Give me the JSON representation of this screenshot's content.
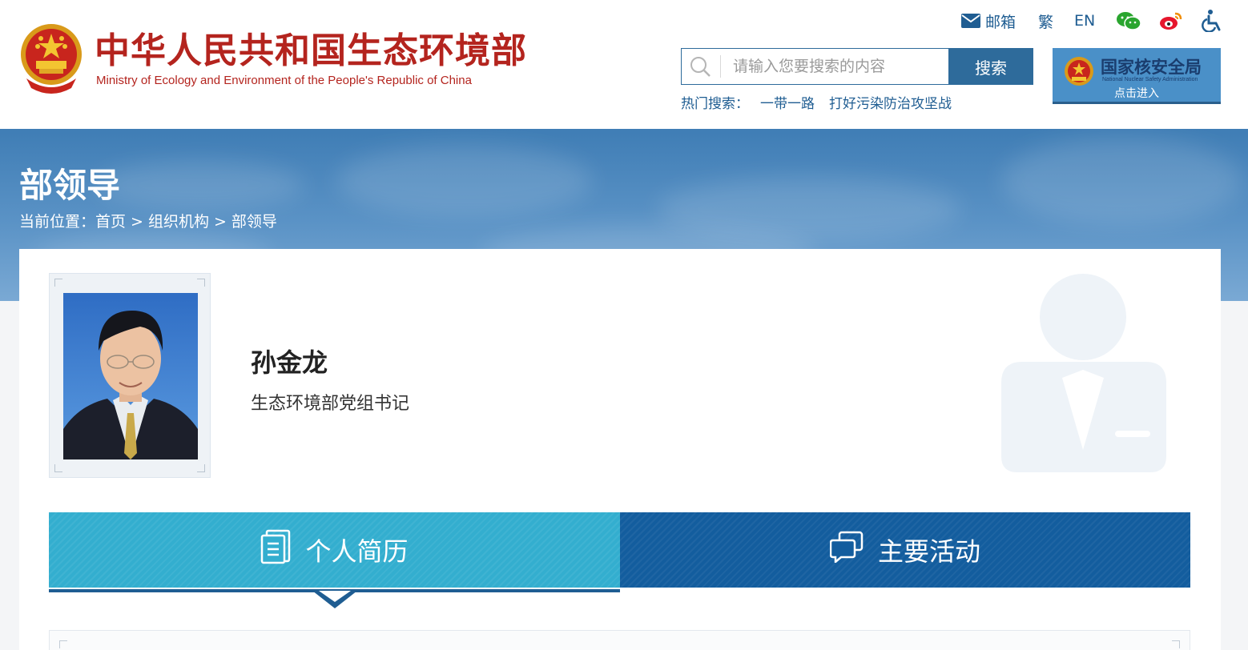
{
  "header": {
    "logo_cn": "中华人民共和国生态环境部",
    "logo_en": "Ministry of Ecology and Environment of the People's Republic of China",
    "emblem_icon": "national-emblem-icon",
    "top_links": {
      "mail_label": "邮箱",
      "traditional_label": "繁",
      "english_label": "EN",
      "wechat_icon": "wechat-icon",
      "weibo_icon": "weibo-icon",
      "accessibility_icon": "accessibility-icon"
    },
    "search": {
      "placeholder": "请输入您要搜索的内容",
      "value": "",
      "button_label": "搜索"
    },
    "hot_search": {
      "label": "热门搜索：",
      "items": [
        "一带一路",
        "打好污染防治攻坚战"
      ]
    },
    "nnsa_banner": {
      "title": "国家核安全局",
      "subtitle": "National Nuclear Safety Administration",
      "enter_label": "点击进入"
    }
  },
  "banner": {
    "page_title": "部领导",
    "breadcrumb": {
      "prefix": "当前位置：",
      "items": [
        "首页",
        "组织机构",
        "部领导"
      ],
      "separator": ">"
    }
  },
  "leader": {
    "name": "孙金龙",
    "title": "生态环境部党组书记"
  },
  "tabs": {
    "resume_label": "个人简历",
    "activity_label": "主要活动"
  },
  "colors": {
    "brand_red": "#b4241e",
    "brand_blue": "#1f5d92",
    "tab_active": "#33aecf",
    "tab_inactive": "#135d9e"
  }
}
